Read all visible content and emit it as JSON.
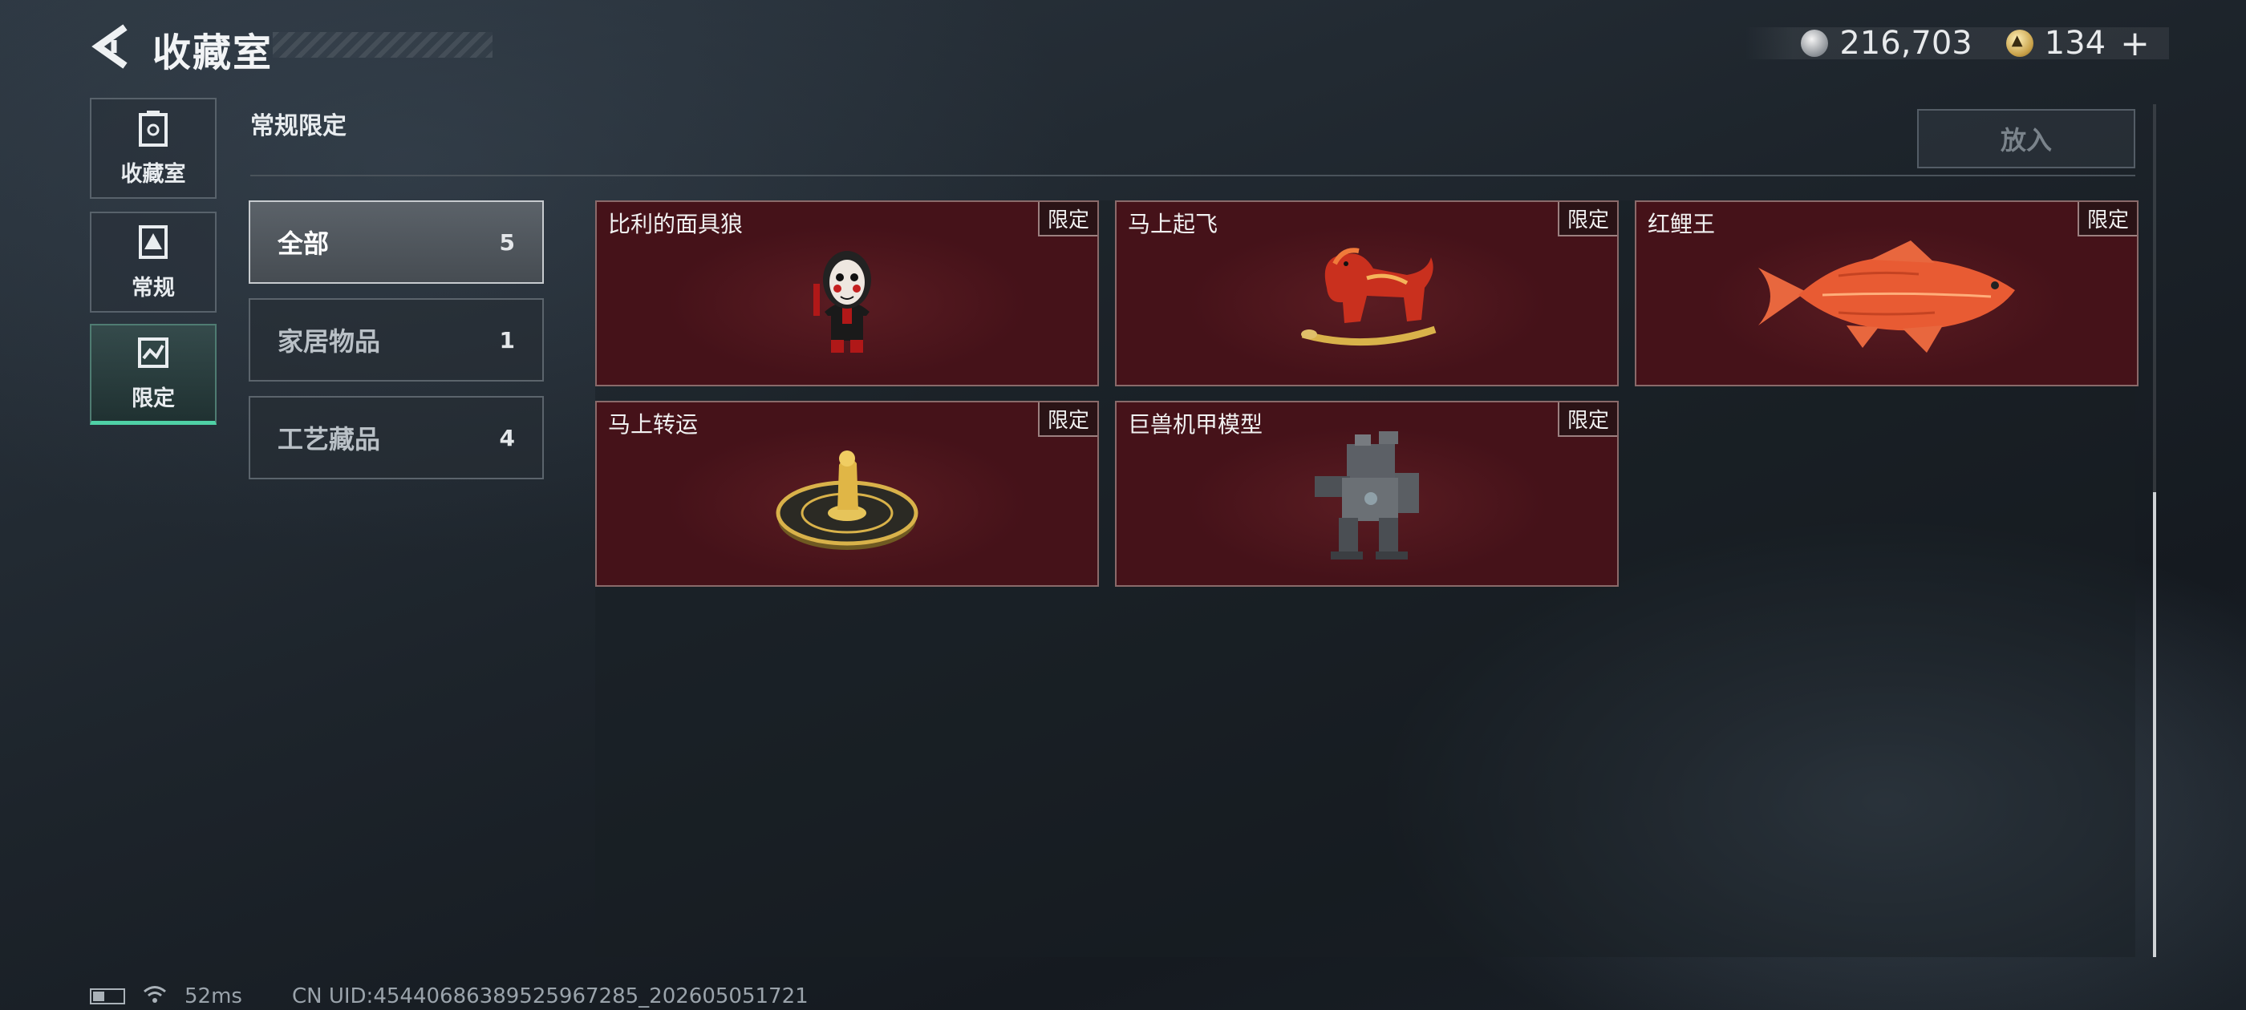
{
  "header": {
    "title": "收藏室",
    "currency_silver": "216,703",
    "currency_gold": "134",
    "plus_label": "+"
  },
  "rail": {
    "items": [
      {
        "label": "收藏室",
        "icon": "trash-bin-icon"
      },
      {
        "label": "常规",
        "icon": "document-triangle-icon"
      },
      {
        "label": "限定",
        "icon": "limited-badge-icon"
      }
    ]
  },
  "section": {
    "title": "常规限定",
    "put_button": "放入"
  },
  "categories": [
    {
      "label": "全部",
      "count": "5"
    },
    {
      "label": "家居物品",
      "count": "1"
    },
    {
      "label": "工艺藏品",
      "count": "4"
    }
  ],
  "cards": [
    {
      "name": "比利的面具狼",
      "tag": "限定",
      "art": "masked-puppet-figure"
    },
    {
      "name": "马上起飞",
      "tag": "限定",
      "art": "red-rocking-horse"
    },
    {
      "name": "红鲤王",
      "tag": "限定",
      "art": "red-carp-fish"
    },
    {
      "name": "马上转运",
      "tag": "限定",
      "art": "golden-fortune-wheel"
    },
    {
      "name": "巨兽机甲模型",
      "tag": "限定",
      "art": "mech-model"
    }
  ],
  "status": {
    "ping": "52ms",
    "uid": "CN UID:45440686389525967285_202605051721"
  },
  "colors": {
    "accent": "#4fd1a6",
    "card_bg": "#4a141b",
    "card_border": "#8a6a6a"
  }
}
